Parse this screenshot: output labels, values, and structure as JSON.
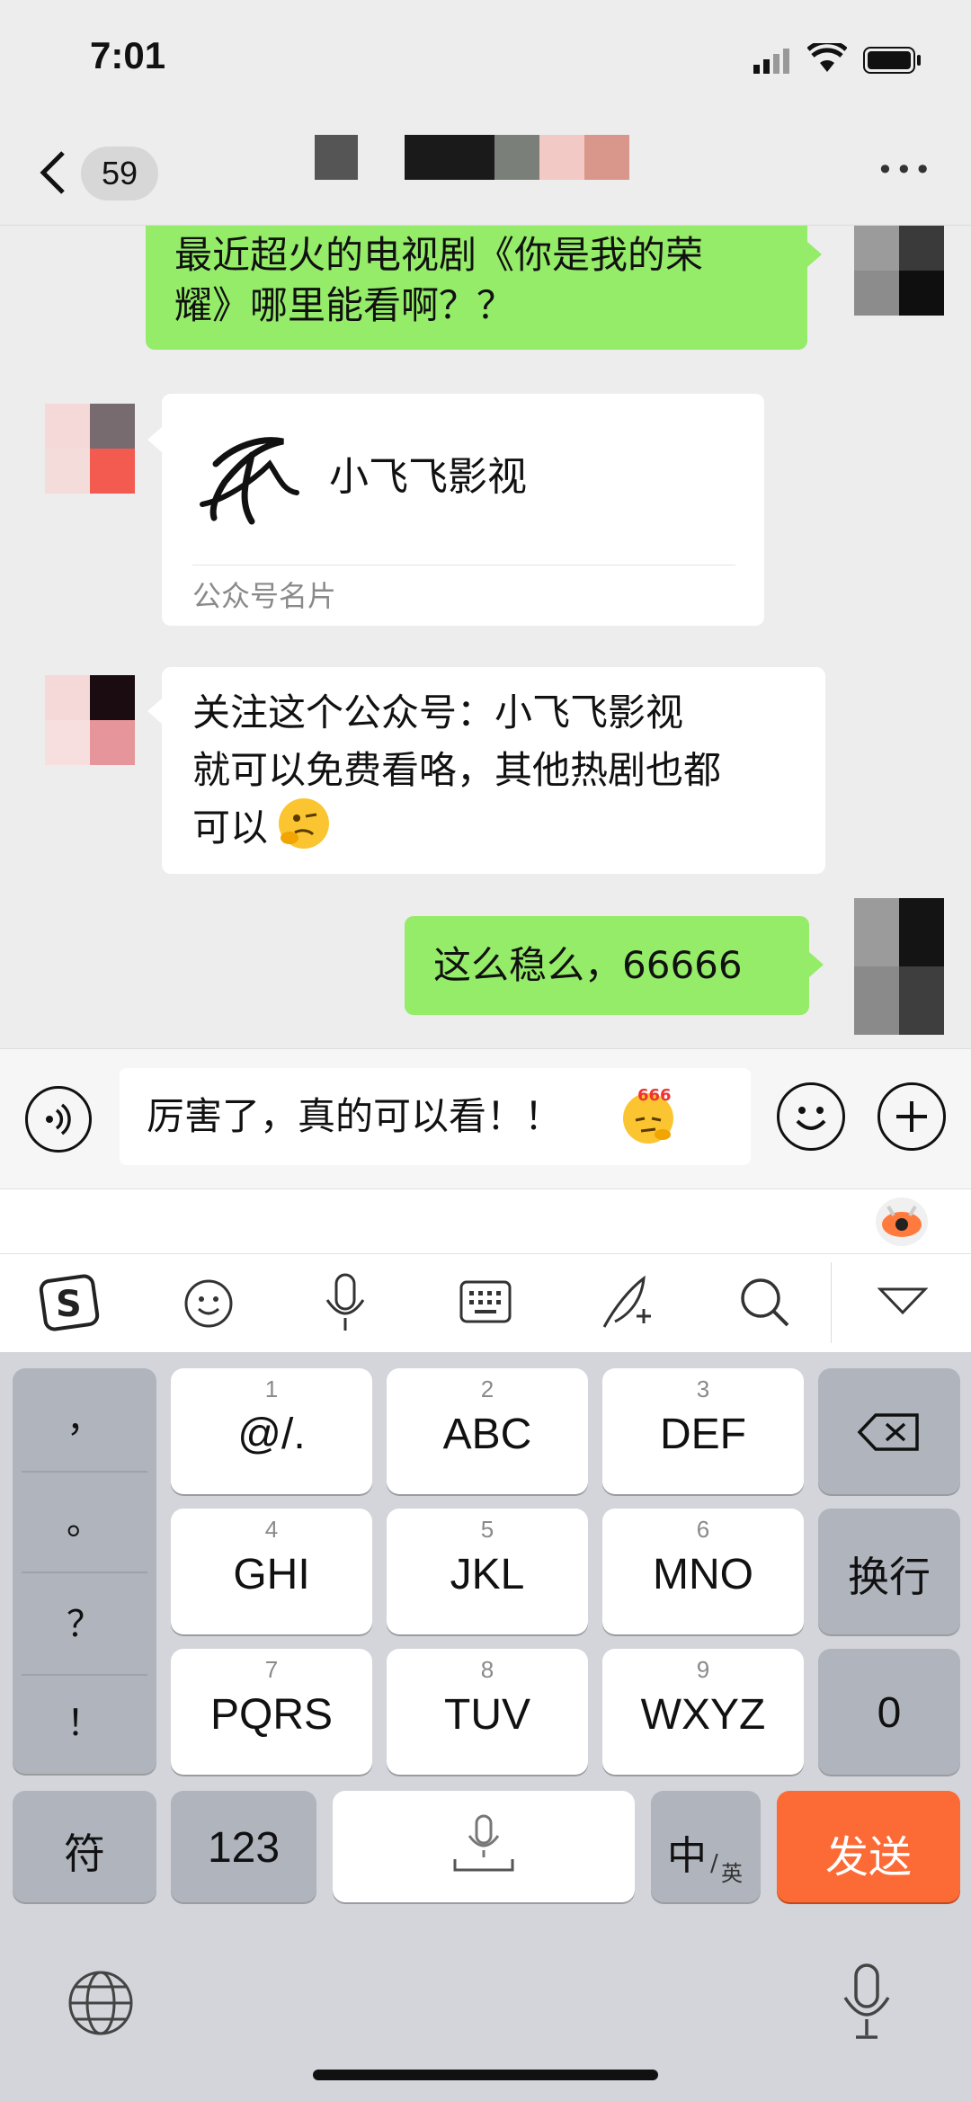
{
  "status_bar": {
    "time": "7:01"
  },
  "nav": {
    "unread_count": "59",
    "more_label": "•••"
  },
  "messages": [
    {
      "side": "right",
      "type": "text",
      "lines": [
        "最近超火的电视剧《你是我的荣",
        "耀》哪里能看啊？？"
      ]
    },
    {
      "side": "left",
      "type": "card",
      "card_name": "小飞飞影视",
      "card_footer": "公众号名片"
    },
    {
      "side": "left",
      "type": "text",
      "lines": [
        "关注这个公众号：小飞飞影视",
        "就可以免费看咯，其他热剧也都",
        "可以"
      ]
    },
    {
      "side": "right",
      "type": "text",
      "lines": [
        "这么稳么，66666"
      ]
    }
  ],
  "input": {
    "value": "厉害了，真的可以看！！",
    "emoji_badge": "666"
  },
  "keyboard": {
    "punctuation": [
      "，",
      "。",
      "？",
      "！"
    ],
    "keys": [
      {
        "num": "1",
        "label": "@/."
      },
      {
        "num": "2",
        "label": "ABC"
      },
      {
        "num": "3",
        "label": "DEF"
      },
      {
        "num": "4",
        "label": "GHI"
      },
      {
        "num": "5",
        "label": "JKL"
      },
      {
        "num": "6",
        "label": "MNO"
      },
      {
        "num": "7",
        "label": "PQRS"
      },
      {
        "num": "8",
        "label": "TUV"
      },
      {
        "num": "9",
        "label": "WXYZ"
      }
    ],
    "newline_label": "换行",
    "zero_label": "0",
    "symbol_label": "符",
    "numeric_label": "123",
    "lang_main": "中",
    "lang_sub": "英",
    "send_label": "发送"
  },
  "colors": {
    "bubble_green": "#95ec69",
    "send_orange": "#fc6a35",
    "background": "#ededed"
  }
}
